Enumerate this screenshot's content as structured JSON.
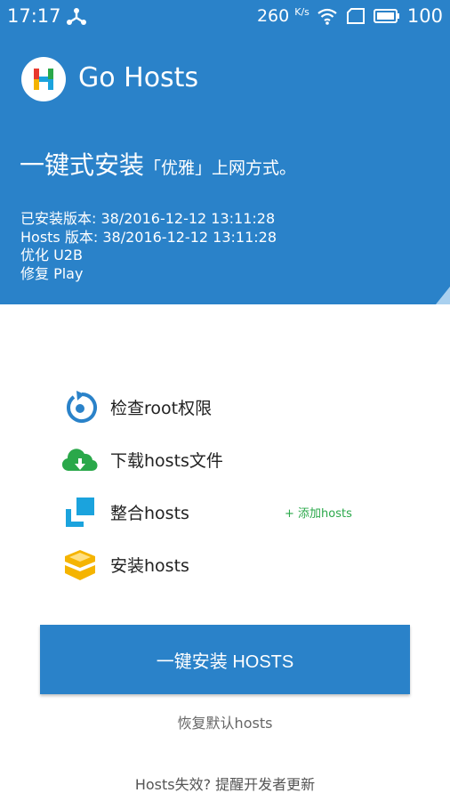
{
  "status_bar": {
    "time": "17:17",
    "network_speed": "260",
    "network_speed_unit": "K/s",
    "battery": "100"
  },
  "app": {
    "title": "Go Hosts",
    "logo_letter": "H"
  },
  "header": {
    "tagline_main": "一键式安装",
    "tagline_sub": "「优雅」上网方式。",
    "installed_version": "已安装版本: 38/2016-12-12 13:11:28",
    "hosts_version": "Hosts 版本: 38/2016-12-12 13:11:28",
    "optimize": "优化  U2B",
    "repair": "修复  Play"
  },
  "steps": [
    {
      "label": "检查root权限",
      "icon": "refresh-icon"
    },
    {
      "label": "下载hosts文件",
      "icon": "cloud-download-icon"
    },
    {
      "label": "整合hosts",
      "icon": "merge-icon"
    },
    {
      "label": "安装hosts",
      "icon": "box-icon"
    }
  ],
  "add_hosts_link": "+ 添加hosts",
  "install_button": "一键安装 HOSTS",
  "restore_link": "恢复默认hosts",
  "feedback_link": "Hosts失效? 提醒开发者更新",
  "colors": {
    "primary": "#2a82c9",
    "green": "#2aa84a",
    "yellow": "#f5b400",
    "cyan": "#1ba3dd"
  }
}
